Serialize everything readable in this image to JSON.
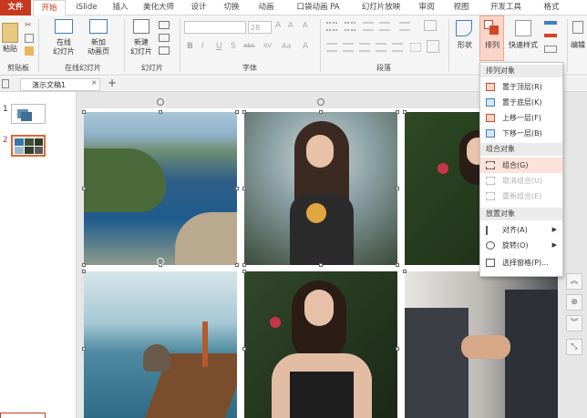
{
  "tabs": [
    "文件",
    "开始",
    "iSlide",
    "插入",
    "美化大师",
    "设计",
    "切换",
    "动画",
    "口袋动画 PA",
    "幻灯片放映",
    "审阅",
    "视图",
    "开发工具",
    "格式"
  ],
  "ribbon": {
    "paste": "粘贴",
    "clipboard_group": "剪贴板",
    "online_slide": "在线\n幻灯片",
    "new_anim_page": "新加\n动画页",
    "online_group": "在线幻灯片",
    "new_slide": "新建\n幻灯片",
    "slides_group": "幻灯片",
    "font_size": "28",
    "font_group": "字体",
    "para_group": "段落",
    "shape": "形状",
    "arrange": "排列",
    "quick_style": "快速样式",
    "edit": "编辑",
    "font_buttons": [
      "B",
      "I",
      "U",
      "S",
      "abc",
      "AV",
      "Aa",
      "A"
    ]
  },
  "docbar": {
    "doc_name": "演示文稿1",
    "add": "+"
  },
  "thumbs": {
    "n1": "1",
    "n2": "2"
  },
  "menu": {
    "section_sort": "排列对象",
    "bring_front": "置于顶层(R)",
    "send_back": "置于底层(K)",
    "bring_forward": "上移一层(F)",
    "send_backward": "下移一层(B)",
    "section_group": "组合对象",
    "group": "组合(G)",
    "ungroup": "取消组合(U)",
    "regroup": "重新组合(E)",
    "section_place": "放置对象",
    "align": "对齐(A)",
    "rotate": "旋转(O)",
    "selection_pane": "选择窗格(P)..."
  }
}
